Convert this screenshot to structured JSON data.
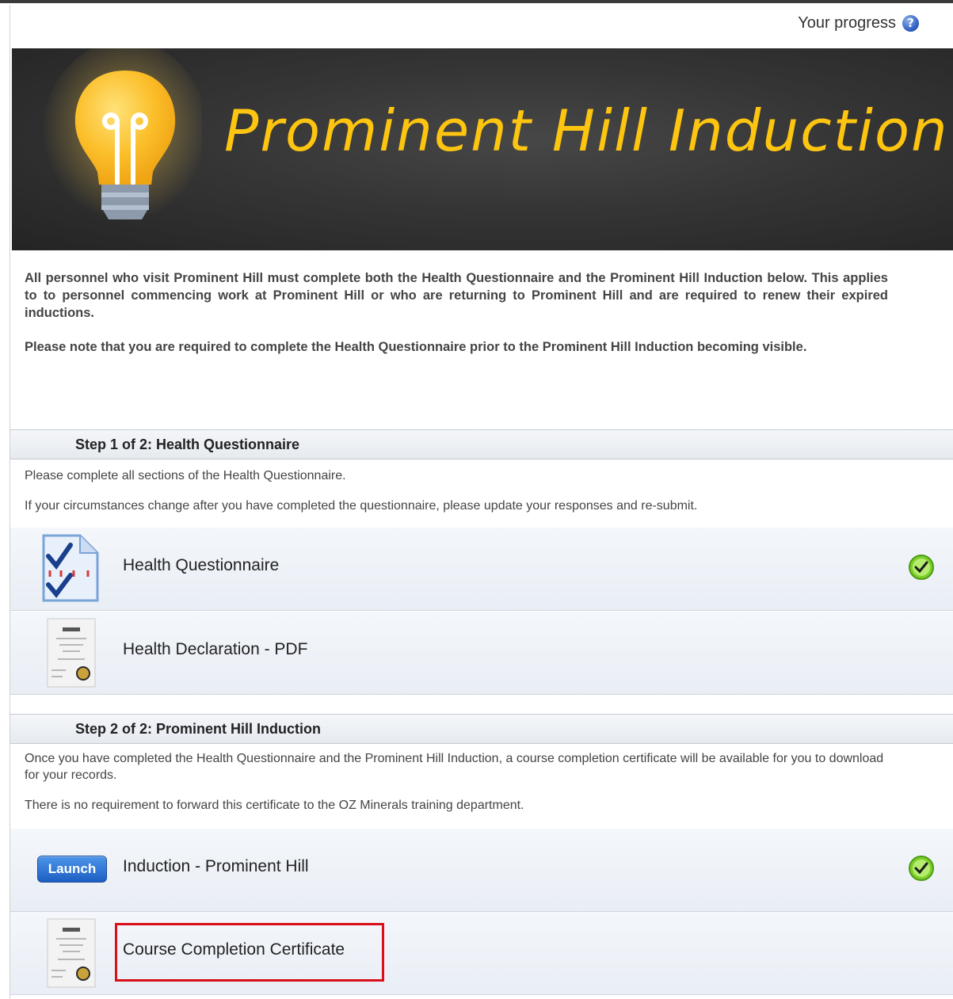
{
  "header": {
    "progress_label": "Your progress",
    "help_icon": "?"
  },
  "banner": {
    "title": "Prominent Hill Induction",
    "icon": "lightbulb-icon"
  },
  "intro": {
    "paragraph1": "All personnel who visit Prominent Hill must complete both the Health Questionnaire and the Prominent Hill Induction below. This applies to to personnel commencing work at Prominent Hill or who are returning to Prominent Hill and are required to renew their expired inductions.",
    "paragraph2": "Please note that you are required to complete the Health Questionnaire prior to the Prominent Hill Induction becoming visible."
  },
  "step1": {
    "title": "Step 1 of 2: Health Questionnaire",
    "desc1": "Please complete all sections of the Health Questionnaire.",
    "desc2": "If your circumstances change after you have completed the questionnaire, please update your responses and re-submit.",
    "activities": [
      {
        "label": "Health Questionnaire",
        "icon": "questionnaire-icon",
        "completed": true
      },
      {
        "label": "Health Declaration - PDF",
        "icon": "certificate-icon",
        "completed": false
      }
    ]
  },
  "step2": {
    "title": "Step 2 of 2: Prominent Hill Induction",
    "desc1": "Once you have completed the Health Questionnaire and the Prominent Hill Induction, a course completion certificate will be available for you to download for your records.",
    "desc2": "There is no requirement to forward this certificate to the OZ Minerals training department.",
    "activities": [
      {
        "label": "Induction - Prominent Hill",
        "button": "Launch",
        "completed": true
      },
      {
        "label": "Course Completion Certificate",
        "icon": "certificate-icon",
        "completed": false,
        "highlighted": true
      }
    ]
  },
  "colors": {
    "banner_text": "#fdc510",
    "highlight": "#d9101a",
    "launch_button": "#1d5fc4",
    "check": "#7ccf2a"
  }
}
